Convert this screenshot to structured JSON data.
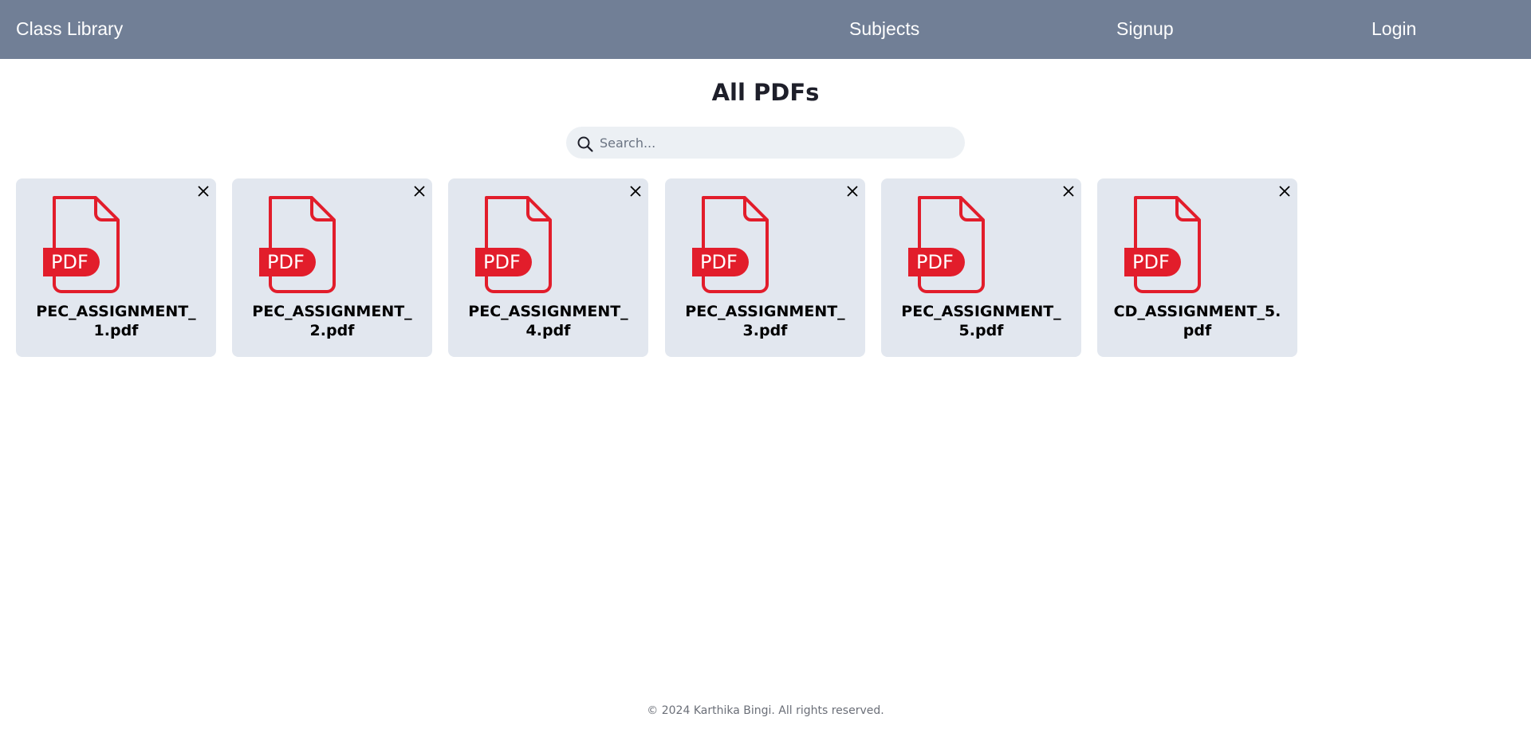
{
  "navbar": {
    "brand": "Class Library",
    "links": {
      "subjects": "Subjects",
      "signup": "Signup",
      "login": "Login"
    },
    "background_color": "#717f96"
  },
  "main": {
    "title": "All PDFs",
    "search": {
      "placeholder": "Search...",
      "value": ""
    },
    "files": [
      {
        "name": "PEC_ASSIGNMENT_1.pdf",
        "icon": "pdf-file-icon",
        "action_icon": "close-icon"
      },
      {
        "name": "PEC_ASSIGNMENT_2.pdf",
        "icon": "pdf-file-icon",
        "action_icon": "close-icon"
      },
      {
        "name": "PEC_ASSIGNMENT_4.pdf",
        "icon": "pdf-file-icon",
        "action_icon": "close-icon"
      },
      {
        "name": "PEC_ASSIGNMENT_3.pdf",
        "icon": "pdf-file-icon",
        "action_icon": "close-icon"
      },
      {
        "name": "PEC_ASSIGNMENT_5.pdf",
        "icon": "pdf-file-icon",
        "action_icon": "close-icon"
      },
      {
        "name": "CD_ASSIGNMENT_5.pdf",
        "icon": "pdf-file-icon",
        "action_icon": "close-icon"
      }
    ],
    "pdf_badge_text": "PDF",
    "pdf_icon_color": "#e21d2b",
    "card_color": "#e2e7ef"
  },
  "footer": {
    "text": "© 2024 Karthika Bingi. All rights reserved."
  }
}
